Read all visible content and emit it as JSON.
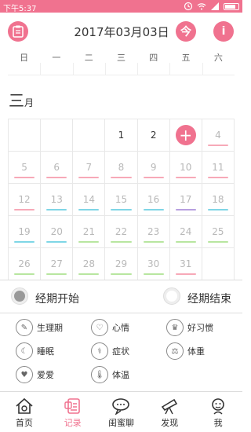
{
  "status": {
    "time": "下午5:37"
  },
  "header": {
    "date": "2017年03月03日",
    "today_label": "今",
    "info_label": "i"
  },
  "weekdays": [
    "日",
    "一",
    "二",
    "三",
    "四",
    "五",
    "六"
  ],
  "month": {
    "number": "三",
    "suffix": "月"
  },
  "calendar": {
    "rows": [
      [
        {
          "d": ""
        },
        {
          "d": ""
        },
        {
          "d": ""
        },
        {
          "d": "1",
          "dark": true
        },
        {
          "d": "2",
          "dark": true
        },
        {
          "plus": true
        },
        {
          "d": "4",
          "bar": "#f7a9b8"
        }
      ],
      [
        {
          "d": "5",
          "bar": "#f7a9b8"
        },
        {
          "d": "6",
          "bar": "#f7a9b8"
        },
        {
          "d": "7",
          "bar": "#f7a9b8"
        },
        {
          "d": "8",
          "bar": "#f7a9b8"
        },
        {
          "d": "9",
          "bar": "#f7a9b8"
        },
        {
          "d": "10",
          "bar": "#f7a9b8"
        },
        {
          "d": "11",
          "bar": "#f7a9b8"
        }
      ],
      [
        {
          "d": "12",
          "bar": "#f7a9b8"
        },
        {
          "d": "13",
          "bar": "#7fd6e6"
        },
        {
          "d": "14",
          "bar": "#7fd6e6"
        },
        {
          "d": "15",
          "bar": "#7fd6e6"
        },
        {
          "d": "16",
          "bar": "#7fd6e6"
        },
        {
          "d": "17",
          "bar": "#b79fe0"
        },
        {
          "d": "18",
          "bar": "#7fd6e6"
        }
      ],
      [
        {
          "d": "19",
          "bar": "#7fd6e6"
        },
        {
          "d": "20",
          "bar": "#7fd6e6"
        },
        {
          "d": "21",
          "bar": "#b8e6a0"
        },
        {
          "d": "22",
          "bar": "#b8e6a0"
        },
        {
          "d": "23",
          "bar": "#b8e6a0"
        },
        {
          "d": "24",
          "bar": "#b8e6a0"
        },
        {
          "d": "25",
          "bar": "#b8e6a0"
        }
      ],
      [
        {
          "d": "26",
          "bar": "#b8e6a0"
        },
        {
          "d": "27",
          "bar": "#b8e6a0"
        },
        {
          "d": "28",
          "bar": "#b8e6a0"
        },
        {
          "d": "29",
          "bar": "#b8e6a0"
        },
        {
          "d": "30",
          "bar": "#b8e6a0"
        },
        {
          "d": "31",
          "bar": "#f7a9b8"
        },
        {
          "d": ""
        }
      ]
    ]
  },
  "period": {
    "start_label": "经期开始",
    "end_label": "经期结束"
  },
  "features": {
    "physiology": "生理期",
    "mood": "心情",
    "habits": "好习惯",
    "sleep": "睡眠",
    "symptoms": "症状",
    "weight": "体重",
    "love": "爱爱",
    "temperature": "体温"
  },
  "nav": {
    "home": "首页",
    "records": "记录",
    "chat": "闺蜜聊",
    "discover": "发现",
    "me": "我"
  },
  "colors": {
    "accent": "#f0728f"
  }
}
